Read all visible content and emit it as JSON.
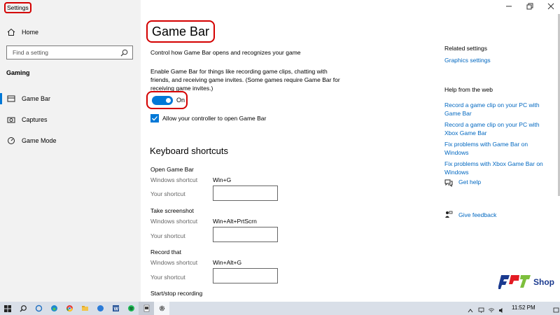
{
  "app": {
    "title": "Settings"
  },
  "sidebar": {
    "home_label": "Home",
    "search_placeholder": "Find a setting",
    "section_label": "Gaming",
    "items": [
      {
        "label": "Game Bar",
        "icon": "game-bar-icon",
        "active": true
      },
      {
        "label": "Captures",
        "icon": "captures-icon",
        "active": false
      },
      {
        "label": "Game Mode",
        "icon": "game-mode-icon",
        "active": false
      }
    ]
  },
  "main": {
    "title": "Game Bar",
    "subtitle": "Control how Game Bar opens and recognizes your game",
    "description_lines": [
      "Enable Game Bar for things like recording game clips, chatting with",
      "friends, and receiving game invites. (Some games require Game Bar for",
      "receiving game invites.)"
    ],
    "toggle_label": "On",
    "checkbox_label": "Allow your controller to open Game Bar",
    "keyboard_header": "Keyboard shortcuts",
    "shortcuts": [
      {
        "name": "Open Game Bar",
        "windows_label": "Windows shortcut",
        "windows_value": "Win+G",
        "your_label": "Your shortcut"
      },
      {
        "name": "Take screenshot",
        "windows_label": "Windows shortcut",
        "windows_value": "Win+Alt+PrtScrn",
        "your_label": "Your shortcut"
      },
      {
        "name": "Record that",
        "windows_label": "Windows shortcut",
        "windows_value": "Win+Alt+G",
        "your_label": "Your shortcut"
      }
    ],
    "next_section": "Start/stop recording"
  },
  "right": {
    "related_header": "Related settings",
    "related_link": "Graphics settings",
    "help_header": "Help from the web",
    "links": [
      [
        "Record a game clip on your PC with",
        "Game Bar"
      ],
      [
        "Record a game clip on your PC with",
        "Xbox Game Bar"
      ],
      [
        "Fix problems with Game Bar on",
        "Windows"
      ],
      [
        "Fix problems with Xbox Game Bar on",
        "Windows"
      ]
    ],
    "get_help": "Get help",
    "give_feedback": "Give feedback"
  },
  "logo": {
    "brand": "FPT",
    "suffix": "Shop"
  },
  "taskbar": {
    "time": "11:52 PM",
    "accent": "#0078d7"
  }
}
